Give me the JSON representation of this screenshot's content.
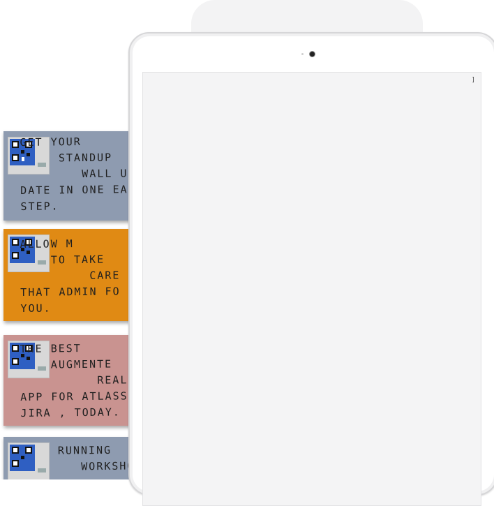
{
  "notes": [
    {
      "color": "#8e9bb0",
      "text": "GET YOUR\n     STANDUP\n        WALL UP\nDATE IN ONE EA\nSTEP."
    },
    {
      "color": "#e08a14",
      "text": "ALLOW M\n    TO TAKE\n         CARE OF\nTHAT ADMIN FO\nYOU."
    },
    {
      "color": "#c99390",
      "text": "THE BEST\n    AUGMENTE\n          REALITY\nAPP FOR ATLASS\nJIRA , TODAY."
    },
    {
      "color": "#8e9bb0",
      "text": "RUNNING\n   WORKSHOPS"
    }
  ],
  "tablet": {
    "screen_marker": "]"
  }
}
